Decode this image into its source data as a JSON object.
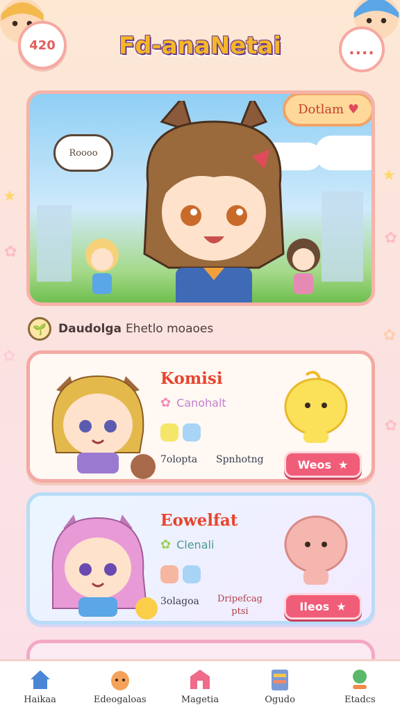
{
  "header": {
    "coin_value": "420",
    "title": "Fd-anaNetai",
    "chat_dots": "...."
  },
  "hero": {
    "badge_label": "Dotlam",
    "speech_text": "Roooo"
  },
  "section": {
    "title_bold": "Daudolga",
    "title_rest": "Ehetlo moaoes"
  },
  "cards": [
    {
      "name": "Komisi",
      "subtitle": "Canohalt",
      "stat_left": "7olopta",
      "stat_right": "Spnhotng",
      "button_label": "Weos",
      "colors": {
        "swatch_a": "#f5e66a",
        "swatch_b": "#a8d4f6"
      }
    },
    {
      "name": "Eowelfat",
      "subtitle": "Clenali",
      "stat_left": "3olagoa",
      "stat_right_line1": "Dripefcag",
      "stat_right_line2": "ptsi",
      "button_label": "Ileos",
      "colors": {
        "swatch_a": "#f7b6a0",
        "swatch_b": "#a8d4f6"
      }
    }
  ],
  "nav": [
    {
      "label": "Haikaa",
      "icon": "home-icon"
    },
    {
      "label": "Edeogaloas",
      "icon": "pet-egg-icon"
    },
    {
      "label": "Magetia",
      "icon": "shop-icon"
    },
    {
      "label": "Ogudo",
      "icon": "shelf-icon"
    },
    {
      "label": "Etadcs",
      "icon": "chart-icon"
    }
  ],
  "theme": {
    "accent": "#f05d78",
    "title_yellow": "#f5b62a",
    "card_border_pink": "#f3a9a3",
    "card_border_blue": "#b8dcf7"
  }
}
